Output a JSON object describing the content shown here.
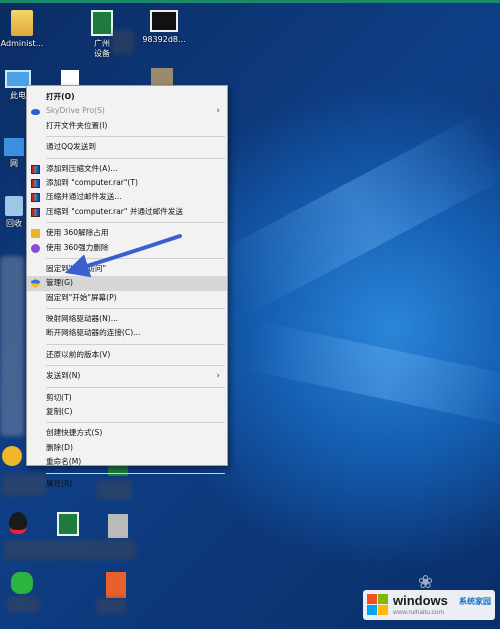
{
  "desktop": {
    "icons": [
      {
        "label": "Administ...",
        "icon": "user-folder-icon"
      },
      {
        "label": "广州",
        "icon": "excel-icon"
      },
      {
        "label": "设备",
        "icon": "excel-icon"
      },
      {
        "label": "98392d8...",
        "icon": "video-thumbnail-icon"
      },
      {
        "label": "此电",
        "icon": "this-pc-icon"
      },
      {
        "label": "网",
        "icon": "network-icon"
      },
      {
        "label": "回收",
        "icon": "recycle-bin-icon"
      }
    ]
  },
  "context_menu": {
    "items": [
      {
        "label": "打开(O)",
        "bold": true
      },
      {
        "label": "SkyDrive Pro(S)",
        "disabled": true,
        "submenu": true,
        "icon": "cloud-icon"
      },
      {
        "label": "打开文件夹位置(I)"
      },
      {
        "sep": true
      },
      {
        "label": "通过QQ发送到"
      },
      {
        "sep": true
      },
      {
        "label": "添加到压缩文件(A)...",
        "icon": "winrar-icon"
      },
      {
        "label": "添加到 \"computer.rar\"(T)",
        "icon": "winrar-icon"
      },
      {
        "label": "压缩并通过邮件发送...",
        "icon": "winrar-icon"
      },
      {
        "label": "压缩到 \"computer.rar\" 并通过邮件发送",
        "icon": "winrar-icon"
      },
      {
        "sep": true
      },
      {
        "label": "使用 360解除占用",
        "icon": "360-unlock-icon"
      },
      {
        "label": "使用 360强力删除",
        "icon": "360-delete-icon"
      },
      {
        "sep": true
      },
      {
        "label": "固定到\"快速访问\""
      },
      {
        "label": "管理(G)",
        "highlighted": true,
        "icon": "shield-icon"
      },
      {
        "label": "固定到\"开始\"屏幕(P)"
      },
      {
        "sep": true
      },
      {
        "label": "映射网络驱动器(N)..."
      },
      {
        "label": "断开网络驱动器的连接(C)..."
      },
      {
        "sep": true
      },
      {
        "label": "还原以前的版本(V)"
      },
      {
        "sep": true
      },
      {
        "label": "发送到(N)",
        "submenu": true
      },
      {
        "sep": true
      },
      {
        "label": "剪切(T)"
      },
      {
        "label": "复制(C)"
      },
      {
        "sep": true
      },
      {
        "label": "创建快捷方式(S)"
      },
      {
        "label": "删除(D)"
      },
      {
        "label": "重命名(M)"
      },
      {
        "sep": true
      },
      {
        "label": "属性(R)"
      }
    ]
  },
  "annotation": {
    "color": "#3a5fcf",
    "target": "管理(G)"
  },
  "watermark": {
    "text": "windows",
    "cn": "系统家园",
    "url": "www.ruihaitu.com"
  },
  "colors": {
    "menu_bg": "#f2f2f2",
    "highlight": "#d6d6d6",
    "desktop": "#0e3f86"
  }
}
